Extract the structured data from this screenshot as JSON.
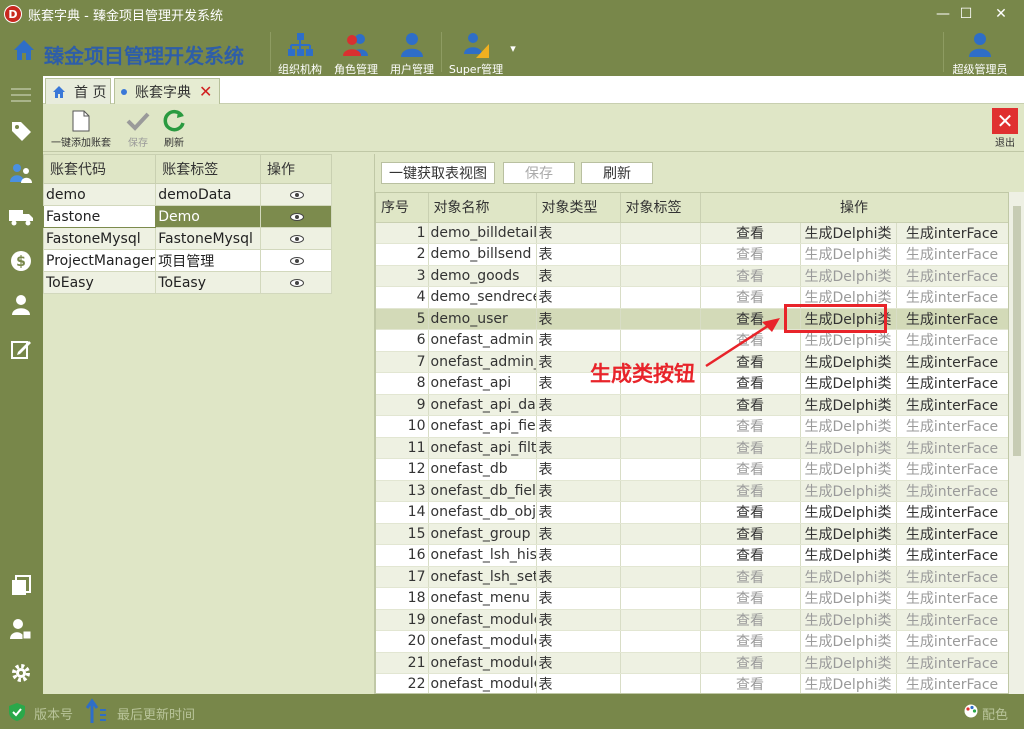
{
  "window": {
    "logo_letter": "D",
    "title": "账套字典 - 臻金项目管理开发系统",
    "min": "—",
    "max": "☐",
    "close": "✕"
  },
  "header": {
    "system_name": "臻金项目管理开发系统",
    "buttons": [
      {
        "label": "组织机构",
        "icon": "org-chart-icon"
      },
      {
        "label": "角色管理",
        "icon": "roles-icon"
      },
      {
        "label": "用户管理",
        "icon": "user-icon"
      },
      {
        "label": "Super管理",
        "icon": "super-admin-icon"
      }
    ],
    "more": "▾",
    "admin_label": "超级管理员"
  },
  "tabs": {
    "home": "首 页",
    "current": "账套字典"
  },
  "subtoolbar": {
    "add": "一键添加账套",
    "save": "保存",
    "refresh": "刷新",
    "exit": "退出"
  },
  "account_table": {
    "headers": [
      "账套代码",
      "账套标签",
      "操作"
    ],
    "rows": [
      {
        "code": "demo",
        "label": "demoData"
      },
      {
        "code": "Fastone",
        "label": "Demo"
      },
      {
        "code": "FastoneMysql",
        "label": "FastoneMysql"
      },
      {
        "code": "ProjectManager",
        "label": "项目管理"
      },
      {
        "code": "ToEasy",
        "label": "ToEasy"
      }
    ],
    "selected_index": 1
  },
  "object_panel": {
    "buttons": {
      "get_views": "一键获取表视图",
      "save": "保存",
      "refresh": "刷新"
    },
    "headers": [
      "序号",
      "对象名称",
      "对象类型",
      "对象标签",
      "操作"
    ],
    "actions": {
      "view": "查看",
      "gen_class": "生成Delphi类",
      "gen_interface": "生成interFace"
    },
    "rows": [
      {
        "no": "1",
        "name": "demo_billdetail",
        "type": "表",
        "dim": false
      },
      {
        "no": "2",
        "name": "demo_billsend",
        "type": "表",
        "dim": true
      },
      {
        "no": "3",
        "name": "demo_goods",
        "type": "表",
        "dim": true
      },
      {
        "no": "4",
        "name": "demo_sendrece",
        "type": "表",
        "dim": true
      },
      {
        "no": "5",
        "name": "demo_user",
        "type": "表",
        "dim": false
      },
      {
        "no": "6",
        "name": "onefast_admin",
        "type": "表",
        "dim": true
      },
      {
        "no": "7",
        "name": "onefast_admin_",
        "type": "表",
        "dim": false
      },
      {
        "no": "8",
        "name": "onefast_api",
        "type": "表",
        "dim": false
      },
      {
        "no": "9",
        "name": "onefast_api_dat",
        "type": "表",
        "dim": false
      },
      {
        "no": "10",
        "name": "onefast_api_fiel",
        "type": "表",
        "dim": true
      },
      {
        "no": "11",
        "name": "onefast_api_filte",
        "type": "表",
        "dim": true
      },
      {
        "no": "12",
        "name": "onefast_db",
        "type": "表",
        "dim": true
      },
      {
        "no": "13",
        "name": "onefast_db_fielc",
        "type": "表",
        "dim": true
      },
      {
        "no": "14",
        "name": "onefast_db_obj",
        "type": "表",
        "dim": false
      },
      {
        "no": "15",
        "name": "onefast_group",
        "type": "表",
        "dim": false
      },
      {
        "no": "16",
        "name": "onefast_lsh_his",
        "type": "表",
        "dim": false
      },
      {
        "no": "17",
        "name": "onefast_lsh_set",
        "type": "表",
        "dim": true
      },
      {
        "no": "18",
        "name": "onefast_menu",
        "type": "表",
        "dim": true
      },
      {
        "no": "19",
        "name": "onefast_module",
        "type": "表",
        "dim": true
      },
      {
        "no": "20",
        "name": "onefast_module",
        "type": "表",
        "dim": true
      },
      {
        "no": "21",
        "name": "onefast_module",
        "type": "表",
        "dim": true
      },
      {
        "no": "22",
        "name": "onefast_module",
        "type": "表",
        "dim": true
      }
    ],
    "highlight_index": 4
  },
  "annotation": {
    "text": "生成类按钮",
    "color": "#e8242a"
  },
  "status": {
    "version": "版本号",
    "updated": "最后更新时间",
    "theme": "配色"
  }
}
